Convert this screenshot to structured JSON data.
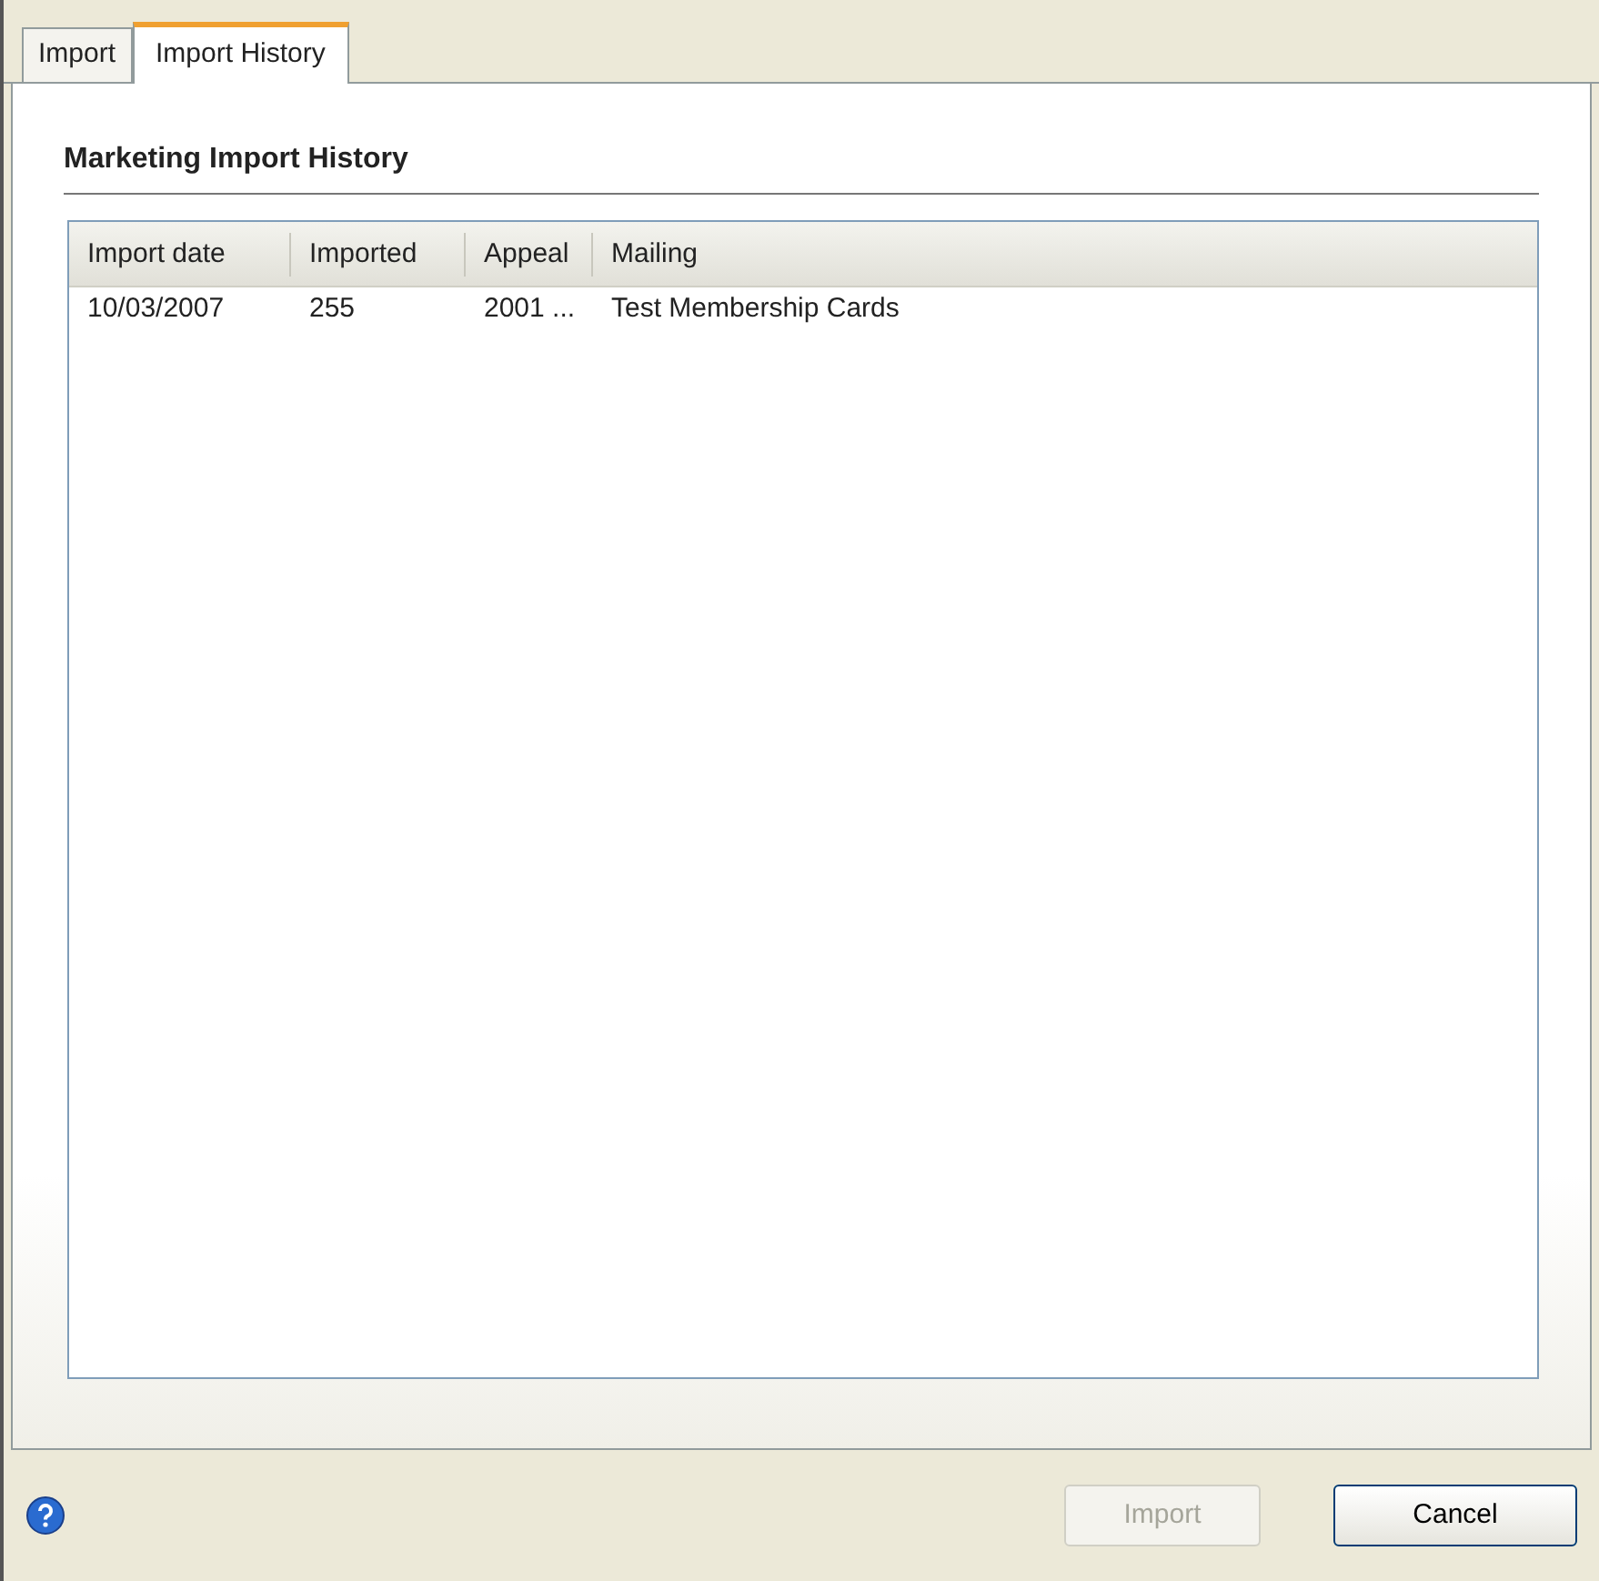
{
  "tabs": [
    {
      "label": "Import",
      "selected": false
    },
    {
      "label": "Import History",
      "selected": true
    }
  ],
  "section_title": "Marketing Import History",
  "table": {
    "columns": [
      "Import date",
      "Imported",
      "Appeal",
      "Mailing"
    ],
    "rows": [
      [
        "10/03/2007",
        "255",
        "2001 ...",
        "Test Membership Cards"
      ]
    ]
  },
  "buttons": [
    {
      "label": "Import",
      "disabled": true
    },
    {
      "label": "Cancel",
      "disabled": false
    }
  ]
}
